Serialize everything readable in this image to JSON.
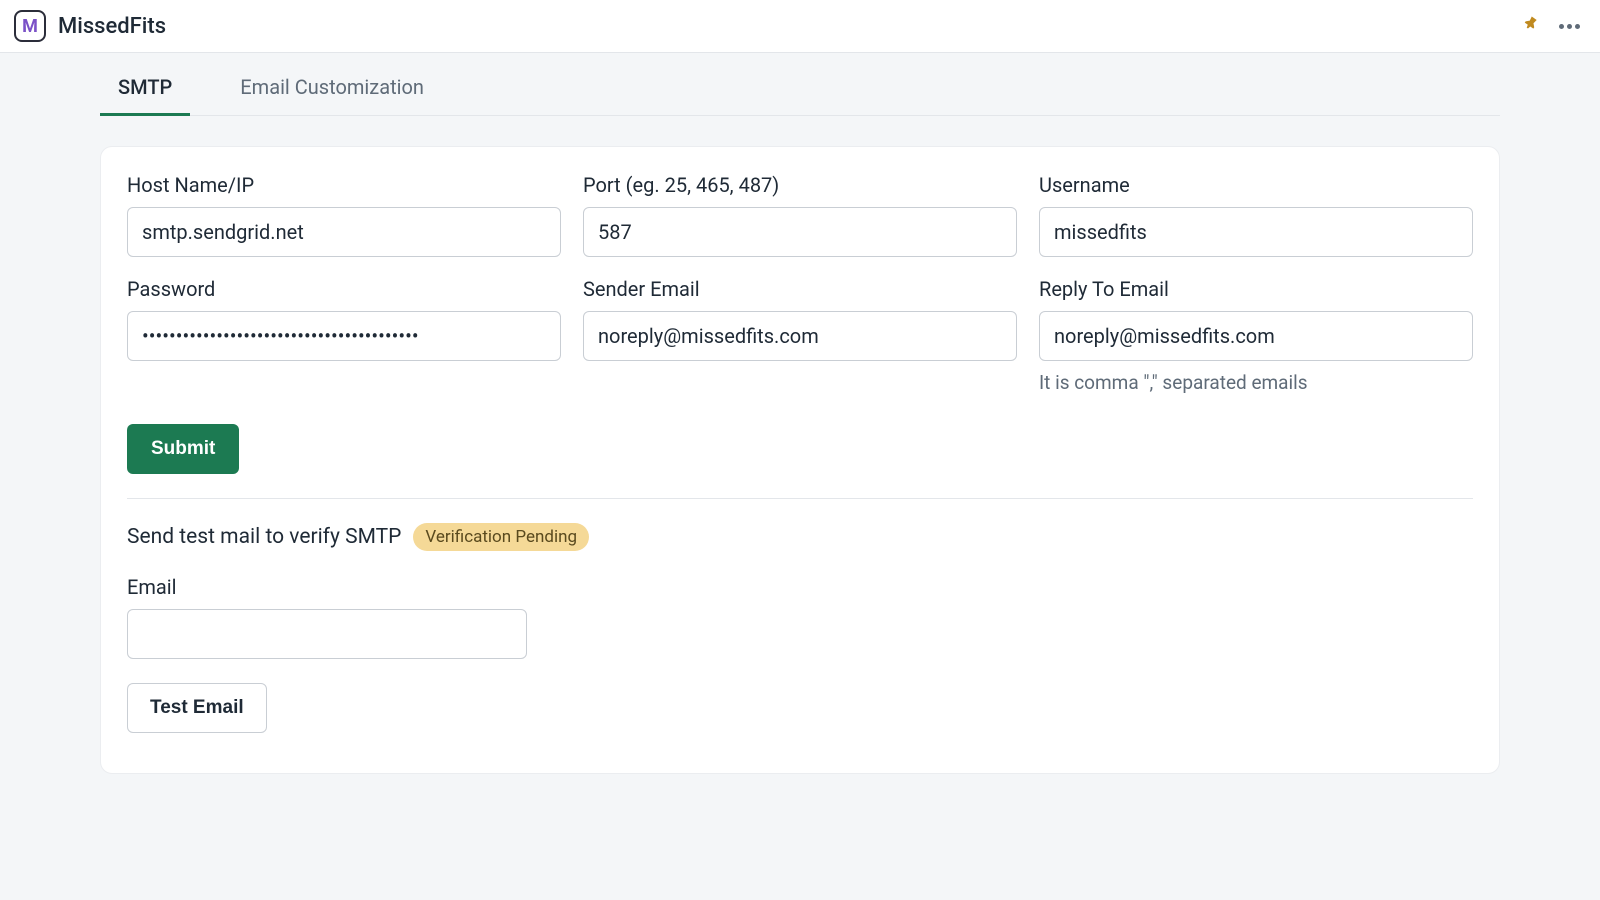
{
  "header": {
    "app_name": "MissedFits",
    "logo_letter": "M"
  },
  "tabs": [
    {
      "label": "SMTP",
      "active": true
    },
    {
      "label": "Email Customization",
      "active": false
    }
  ],
  "form": {
    "host": {
      "label": "Host Name/IP",
      "value": "smtp.sendgrid.net"
    },
    "port": {
      "label": "Port (eg. 25, 465, 487)",
      "value": "587"
    },
    "username": {
      "label": "Username",
      "value": "missedfits"
    },
    "password": {
      "label": "Password",
      "value": "•••••••••••••••••••••••••••••••••••••••••"
    },
    "sender_email": {
      "label": "Sender Email",
      "value": "noreply@missedfits.com"
    },
    "reply_to": {
      "label": "Reply To Email",
      "value": "noreply@missedfits.com",
      "helper": "It is comma \",\" separated emails"
    },
    "submit_label": "Submit"
  },
  "test_section": {
    "heading": "Send test mail to verify SMTP",
    "badge": "Verification Pending",
    "email_label": "Email",
    "email_value": "",
    "button_label": "Test Email"
  }
}
